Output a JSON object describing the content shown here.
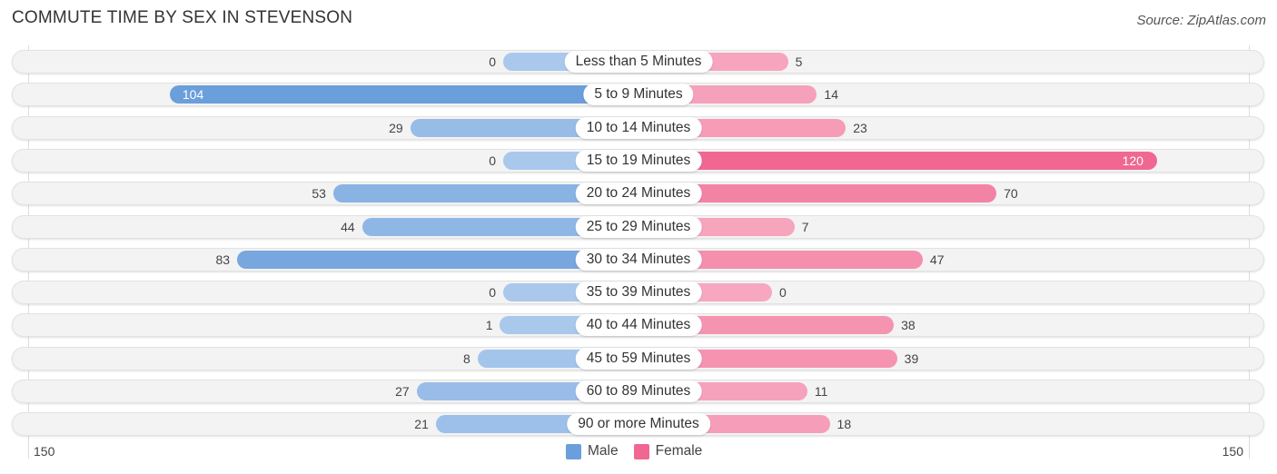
{
  "title": "COMMUTE TIME BY SEX IN STEVENSON",
  "source": "Source: ZipAtlas.com",
  "colors": {
    "male": "#6a9fdb",
    "male_light": "#a9c8ec",
    "female": "#f06892",
    "female_light": "#f7a8c0"
  },
  "chart_data": {
    "type": "bar",
    "orientation": "horizontal-diverging",
    "title": "COMMUTE TIME BY SEX IN STEVENSON",
    "categories": [
      "Less than 5 Minutes",
      "5 to 9 Minutes",
      "10 to 14 Minutes",
      "15 to 19 Minutes",
      "20 to 24 Minutes",
      "25 to 29 Minutes",
      "30 to 34 Minutes",
      "35 to 39 Minutes",
      "40 to 44 Minutes",
      "45 to 59 Minutes",
      "60 to 89 Minutes",
      "90 or more Minutes"
    ],
    "series": [
      {
        "name": "Male",
        "values": [
          0,
          104,
          29,
          0,
          53,
          44,
          83,
          0,
          1,
          8,
          27,
          21
        ]
      },
      {
        "name": "Female",
        "values": [
          5,
          14,
          23,
          120,
          70,
          7,
          47,
          0,
          38,
          39,
          11,
          18
        ]
      }
    ],
    "axis": {
      "left_tick": "150",
      "right_tick": "150",
      "range": [
        -150,
        150
      ]
    },
    "legend": [
      {
        "label": "Male"
      },
      {
        "label": "Female"
      }
    ],
    "legend_position": "bottom-center",
    "xlabel": "",
    "ylabel": ""
  }
}
